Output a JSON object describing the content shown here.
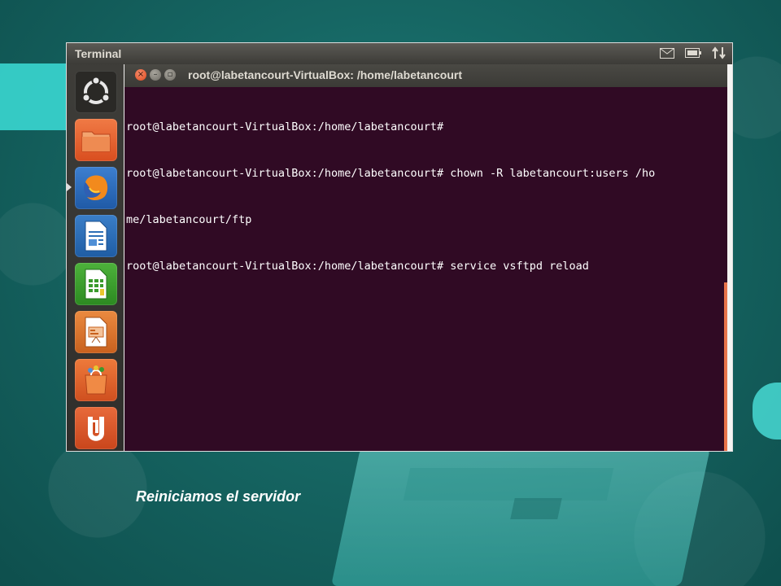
{
  "topbar": {
    "title": "Terminal",
    "tray_icons": [
      "mail-icon",
      "battery-icon",
      "network-icon"
    ]
  },
  "launcher": {
    "items": [
      {
        "name": "dash-home",
        "icon": "ubuntu-logo-icon",
        "color": "#2c2b28"
      },
      {
        "name": "files",
        "icon": "folder-icon",
        "color": "#e35b2a"
      },
      {
        "name": "firefox",
        "icon": "firefox-icon",
        "color": "#2a6cc5"
      },
      {
        "name": "writer",
        "icon": "document-icon",
        "color": "#2d6fb6"
      },
      {
        "name": "calc",
        "icon": "spreadsheet-icon",
        "color": "#3a9a2c"
      },
      {
        "name": "impress",
        "icon": "presentation-icon",
        "color": "#d86d27"
      },
      {
        "name": "software-center",
        "icon": "shopping-bag-icon",
        "color": "#e0642b"
      },
      {
        "name": "ubuntu-one",
        "icon": "ubuntu-one-icon",
        "color": "#d8512b"
      }
    ]
  },
  "window": {
    "title": "root@labetancourt-VirtualBox: /home/labetancourt",
    "buttons": {
      "close": "×",
      "minimize": "–",
      "maximize": "▫"
    }
  },
  "terminal": {
    "lines": [
      "root@labetancourt-VirtualBox:/home/labetancourt#",
      "root@labetancourt-VirtualBox:/home/labetancourt# chown -R labetancourt:users /ho",
      "me/labetancourt/ftp",
      "root@labetancourt-VirtualBox:/home/labetancourt# service vsftpd reload"
    ],
    "background": "#300a24",
    "foreground": "#ffffff"
  },
  "caption": "Reiniciamos el servidor"
}
